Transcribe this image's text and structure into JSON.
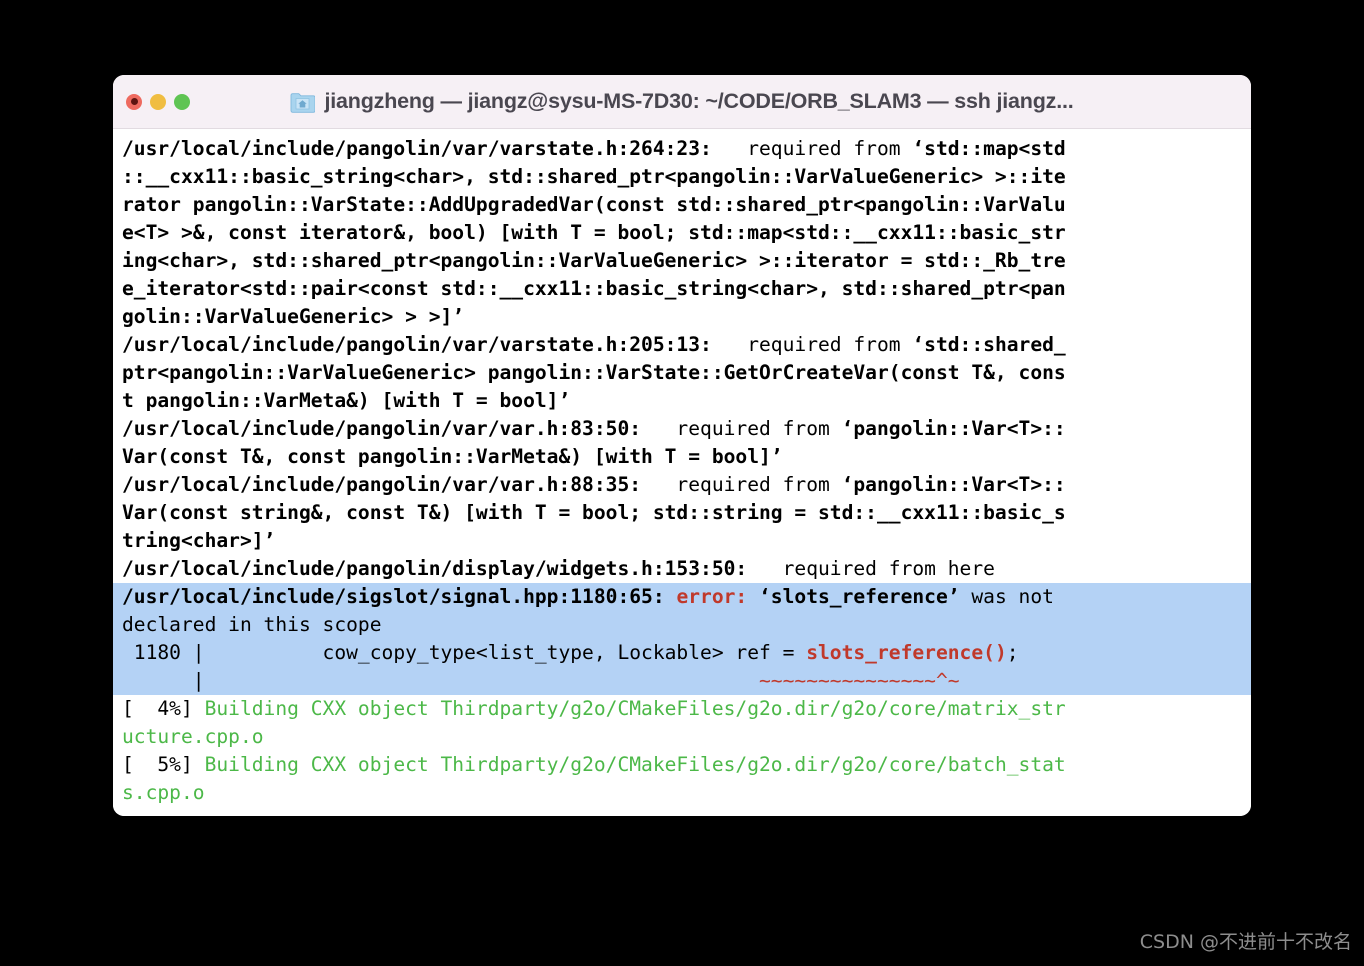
{
  "window": {
    "title": "jiangzheng — jiangz@sysu-MS-7D30: ~/CODE/ORB_SLAM3 — ssh jiangz...",
    "folder_icon": "folder-home-icon",
    "traffic_lights": {
      "close_label": "close",
      "minimize_label": "minimize",
      "maximize_label": "maximize",
      "close_color": "#ee6a5f",
      "minimize_color": "#f0bd41",
      "maximize_color": "#5fc453"
    },
    "titlebar_color": "#f6f0f5",
    "body_color": "#ffffff"
  },
  "colors": {
    "highlight": "#b4d2f5",
    "error": "#c0392b",
    "success_green": "#4cb848",
    "text": "#000000"
  },
  "terminal": {
    "lines": [
      {
        "id": "l1",
        "segments": [
          {
            "t": "/usr/local/include/pangolin/var/varstate.h:264:23:",
            "s": "b"
          },
          {
            "t": "   required from ",
            "s": "n"
          },
          {
            "t": "‘std::map<std",
            "s": "b"
          }
        ]
      },
      {
        "id": "l2",
        "segments": [
          {
            "t": "::__cxx11::basic_string<char>, std::shared_ptr<pangolin::VarValueGeneric> >::ite",
            "s": "b"
          }
        ]
      },
      {
        "id": "l3",
        "segments": [
          {
            "t": "rator pangolin::VarState::AddUpgradedVar(const std::shared_ptr<pangolin::VarValu",
            "s": "b"
          }
        ]
      },
      {
        "id": "l4",
        "segments": [
          {
            "t": "e<T> >&, const iterator&, bool) [with T = bool; std::map<std::__cxx11::basic_str",
            "s": "b"
          }
        ]
      },
      {
        "id": "l5",
        "segments": [
          {
            "t": "ing<char>, std::shared_ptr<pangolin::VarValueGeneric> >::iterator = std::_Rb_tre",
            "s": "b"
          }
        ]
      },
      {
        "id": "l6",
        "segments": [
          {
            "t": "e_iterator<std::pair<const std::__cxx11::basic_string<char>, std::shared_ptr<pan",
            "s": "b"
          }
        ]
      },
      {
        "id": "l7",
        "segments": [
          {
            "t": "golin::VarValueGeneric> > >]’",
            "s": "b"
          }
        ]
      },
      {
        "id": "l8",
        "segments": [
          {
            "t": "/usr/local/include/pangolin/var/varstate.h:205:13:",
            "s": "b"
          },
          {
            "t": "   required from ",
            "s": "n"
          },
          {
            "t": "‘std::shared_",
            "s": "b"
          }
        ]
      },
      {
        "id": "l9",
        "segments": [
          {
            "t": "ptr<pangolin::VarValueGeneric> pangolin::VarState::GetOrCreateVar(const T&, cons",
            "s": "b"
          }
        ]
      },
      {
        "id": "l10",
        "segments": [
          {
            "t": "t pangolin::VarMeta&) [with T = bool]’",
            "s": "b"
          }
        ]
      },
      {
        "id": "l11",
        "segments": [
          {
            "t": "/usr/local/include/pangolin/var/var.h:83:50:",
            "s": "b"
          },
          {
            "t": "   required from ",
            "s": "n"
          },
          {
            "t": "‘pangolin::Var<T>::",
            "s": "b"
          }
        ]
      },
      {
        "id": "l12",
        "segments": [
          {
            "t": "Var(const T&, const pangolin::VarMeta&) [with T = bool]’",
            "s": "b"
          }
        ]
      },
      {
        "id": "l13",
        "segments": [
          {
            "t": "/usr/local/include/pangolin/var/var.h:88:35:",
            "s": "b"
          },
          {
            "t": "   required from ",
            "s": "n"
          },
          {
            "t": "‘pangolin::Var<T>::",
            "s": "b"
          }
        ]
      },
      {
        "id": "l14",
        "segments": [
          {
            "t": "Var(const string&, const T&) [with T = bool; std::string = std::__cxx11::basic_s",
            "s": "b"
          }
        ]
      },
      {
        "id": "l15",
        "segments": [
          {
            "t": "tring<char>]’",
            "s": "b"
          }
        ]
      },
      {
        "id": "l16",
        "segments": [
          {
            "t": "/usr/local/include/pangolin/display/widgets.h:153:50:",
            "s": "b"
          },
          {
            "t": "   required from here",
            "s": "n"
          }
        ]
      },
      {
        "id": "l17",
        "highlight": true,
        "segments": [
          {
            "t": "/usr/local/include/sigslot/signal.hpp:1180:65: ",
            "s": "b"
          },
          {
            "t": "error: ",
            "s": "err"
          },
          {
            "t": "‘slots_reference’",
            "s": "b"
          },
          {
            "t": " was not",
            "s": "n"
          }
        ]
      },
      {
        "id": "l18",
        "highlight": true,
        "segments": [
          {
            "t": "declared in this scope",
            "s": "n"
          }
        ]
      },
      {
        "id": "l19",
        "highlight": true,
        "segments": [
          {
            "t": " 1180 |          cow_copy_type<list_type, Lockable> ref = ",
            "s": "n"
          },
          {
            "t": "slots_reference()",
            "s": "err"
          },
          {
            "t": ";",
            "s": "n"
          }
        ]
      },
      {
        "id": "l20",
        "highlight": true,
        "segments": [
          {
            "t": "      |                                               ",
            "s": "n"
          },
          {
            "t": "~~~~~~~~~~~~~~~^~",
            "s": "errn"
          }
        ]
      },
      {
        "id": "l21",
        "segments": [
          {
            "t": "[",
            "s": "blk"
          },
          {
            "t": "  4%",
            "s": "blk"
          },
          {
            "t": "] ",
            "s": "blk"
          },
          {
            "t": "Building CXX object Thirdparty/g2o/CMakeFiles/g2o.dir/g2o/core/matrix_str",
            "s": "grn"
          }
        ]
      },
      {
        "id": "l22",
        "segments": [
          {
            "t": "ucture.cpp.o",
            "s": "grn"
          }
        ]
      },
      {
        "id": "l23",
        "segments": [
          {
            "t": "[",
            "s": "blk"
          },
          {
            "t": "  5%",
            "s": "blk"
          },
          {
            "t": "] ",
            "s": "blk"
          },
          {
            "t": "Building CXX object Thirdparty/g2o/CMakeFiles/g2o.dir/g2o/core/batch_stat",
            "s": "grn"
          }
        ]
      },
      {
        "id": "l24",
        "segments": [
          {
            "t": "s.cpp.o",
            "s": "grn"
          }
        ]
      }
    ]
  },
  "watermark": {
    "text": "CSDN @不进前十不改名"
  }
}
